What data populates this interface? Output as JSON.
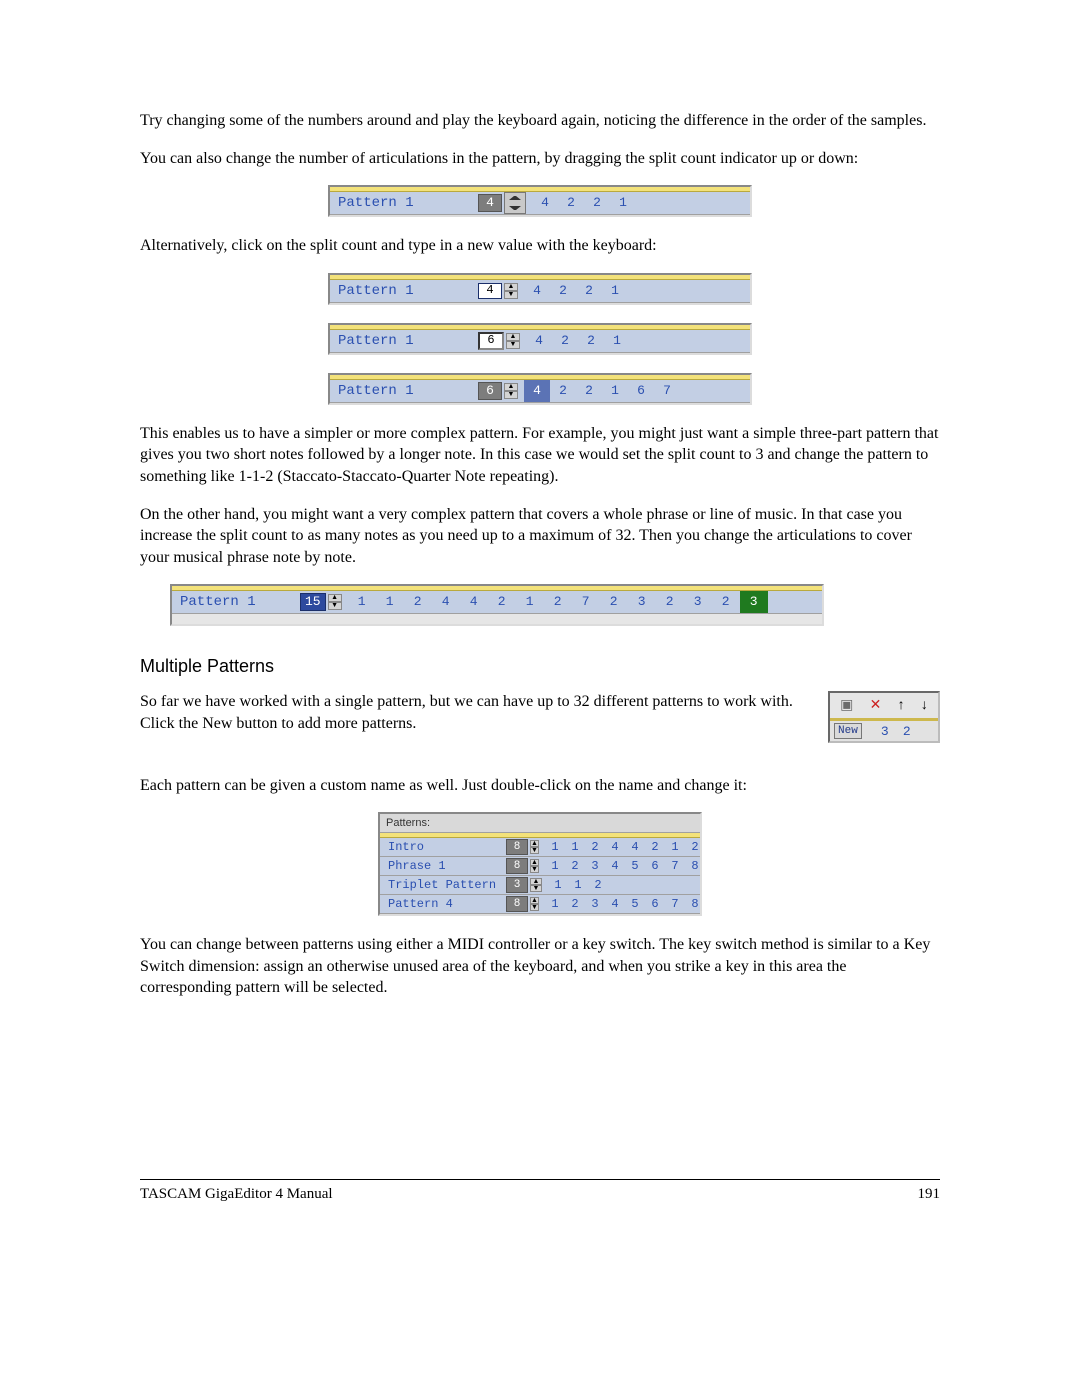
{
  "paragraphs": {
    "p1": "Try changing some of the numbers around and play the keyboard again, noticing the difference in the order of the samples.",
    "p2": "You can also change the number of articulations in the pattern, by dragging the split count indicator up or down:",
    "p3": "Alternatively, click on the split count and type in a new value with the keyboard:",
    "p4": "This enables us to have a simpler or more complex pattern.  For example, you might just want a simple three-part pattern that gives you two short notes followed by a longer note.  In this case we would set the split count to 3 and change the pattern to something like 1-1-2 (Staccato-Staccato-Quarter Note repeating).",
    "p5": "On the other hand, you might want a very complex pattern that covers a whole phrase or line of music. In that case you increase the split count to as many notes as you need up to a maximum of 32.  Then you change the articulations to cover your musical phrase note by note.",
    "p6a": "So far we have worked with a single pattern, but we can have up to 32 different patterns to work with.  Click the New button to add more patterns.",
    "p7": "Each pattern can be given a custom name as well.  Just double-click on the name and change it:",
    "p8": "You can change between patterns using either a MIDI controller or a key switch.  The key switch method is similar to a Key Switch dimension: assign an otherwise unused area of the keyboard, and when you strike a key in this area the corresponding pattern will be selected."
  },
  "headings": {
    "multiple_patterns": "Multiple Patterns"
  },
  "fig1": {
    "name": "Pattern 1",
    "count": "4",
    "values": [
      "4",
      "2",
      "2",
      "1"
    ]
  },
  "fig2": {
    "name": "Pattern 1",
    "count": "4",
    "values": [
      "4",
      "2",
      "2",
      "1"
    ]
  },
  "fig3": {
    "name": "Pattern 1",
    "count": "6",
    "values": [
      "4",
      "2",
      "2",
      "1"
    ]
  },
  "fig4": {
    "name": "Pattern 1",
    "count": "6",
    "values": [
      "4",
      "2",
      "2",
      "1",
      "6",
      "7"
    ]
  },
  "fig5": {
    "name": "Pattern 1",
    "count": "15",
    "values": [
      "1",
      "1",
      "2",
      "4",
      "4",
      "2",
      "1",
      "2",
      "7",
      "2",
      "3",
      "2",
      "3",
      "2",
      "3"
    ]
  },
  "toolbar": {
    "new_label": "New",
    "n1": "3",
    "n2": "2"
  },
  "patterns_table": {
    "header": "Patterns:",
    "rows": [
      {
        "name": "Intro",
        "count": "8",
        "values": [
          "1",
          "1",
          "2",
          "4",
          "4",
          "2",
          "1",
          "2"
        ]
      },
      {
        "name": "Phrase 1",
        "count": "8",
        "values": [
          "1",
          "2",
          "3",
          "4",
          "5",
          "6",
          "7",
          "8"
        ]
      },
      {
        "name": "Triplet Pattern",
        "count": "3",
        "values": [
          "1",
          "1",
          "2"
        ]
      },
      {
        "name": "Pattern 4",
        "count": "8",
        "values": [
          "1",
          "2",
          "3",
          "4",
          "5",
          "6",
          "7",
          "8"
        ]
      }
    ]
  },
  "footer": {
    "title": "TASCAM GigaEditor 4 Manual",
    "page": "191"
  }
}
